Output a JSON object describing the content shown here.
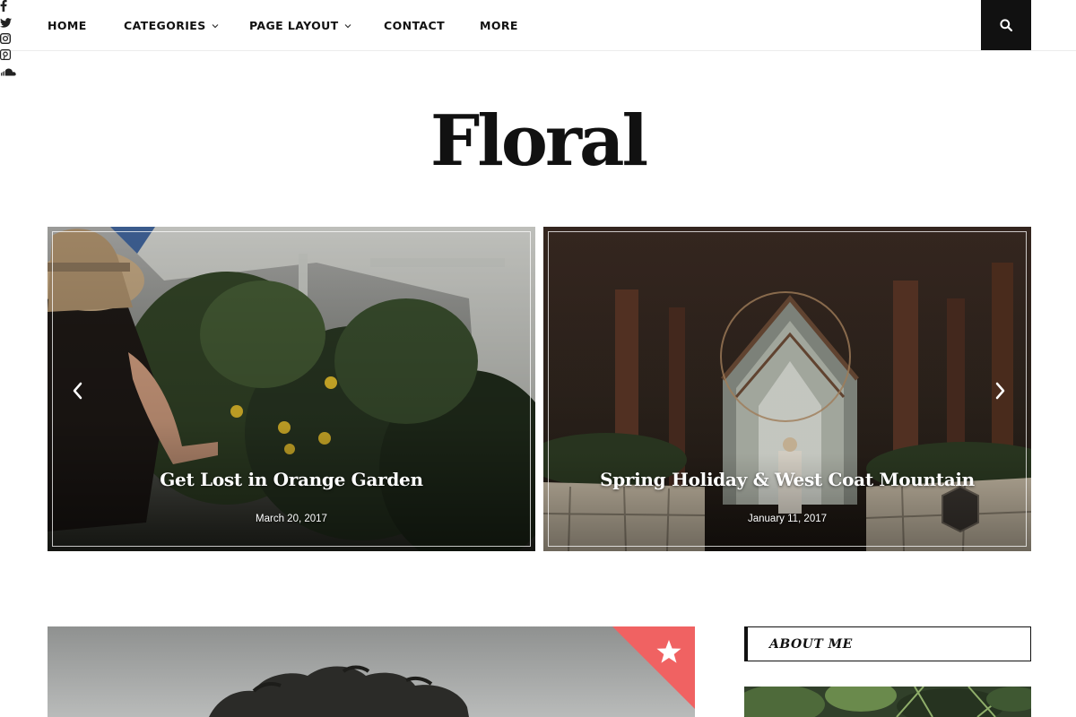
{
  "nav": {
    "items": [
      {
        "label": "HOME",
        "has_dropdown": false
      },
      {
        "label": "CATEGORIES",
        "has_dropdown": true
      },
      {
        "label": "PAGE LAYOUT",
        "has_dropdown": true
      },
      {
        "label": "CONTACT",
        "has_dropdown": false
      },
      {
        "label": "MORE",
        "has_dropdown": false
      }
    ],
    "social_icons": [
      "facebook-icon",
      "twitter-icon",
      "instagram-icon",
      "pinterest-icon",
      "soundcloud-icon"
    ],
    "search_icon": "search-icon"
  },
  "site": {
    "logo": "Floral"
  },
  "slider": {
    "slides": [
      {
        "title": "Get Lost in Orange Garden",
        "date": "March 20, 2017"
      },
      {
        "title": "Spring Holiday & West Coat Mountain",
        "date": "January 11, 2017"
      }
    ],
    "prev_icon": "chevron-left-icon",
    "next_icon": "chevron-right-icon"
  },
  "featured": {
    "badge_icon": "star-icon",
    "badge_color": "#f06262"
  },
  "sidebar": {
    "about_title": "ABOUT ME"
  },
  "colors": {
    "text": "#111111",
    "accent": "#f06262",
    "search_bg": "#111111"
  }
}
